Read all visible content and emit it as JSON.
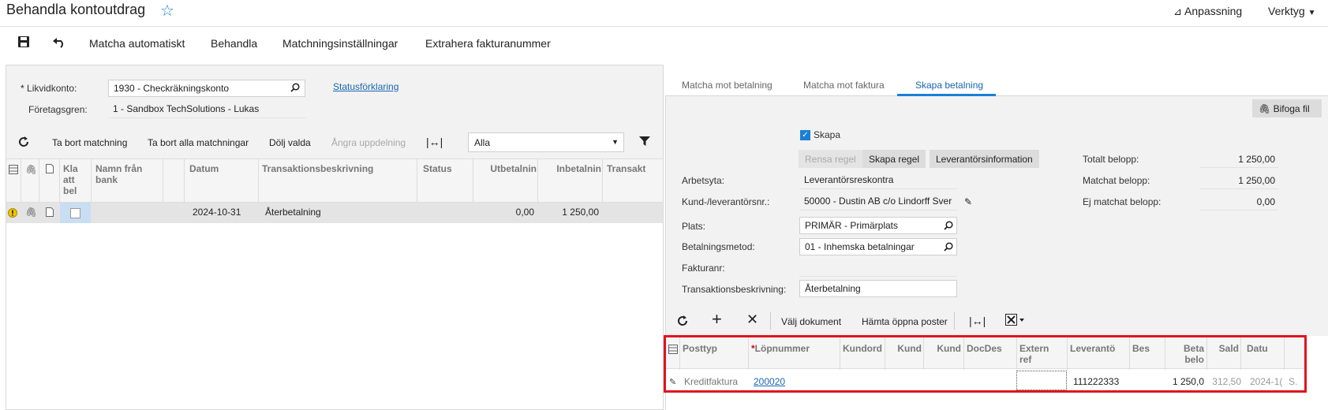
{
  "header": {
    "title": "Behandla kontoutdrag",
    "customize_label": "Anpassning",
    "tools_label": "Verktyg"
  },
  "toolbar": {
    "match_auto": "Matcha automatiskt",
    "process": "Behandla",
    "match_settings": "Matchningsinställningar",
    "extract_invoice": "Extrahera fakturanummer"
  },
  "left_form": {
    "cash_account_label": "Likvidkonto:",
    "cash_account_value": "1930 - Checkräkningskonto",
    "branch_label": "Företagsgren:",
    "branch_value": "1 - Sandbox TechSolutions - Lukas",
    "status_link": "Statusförklaring"
  },
  "left_grid_toolbar": {
    "remove_match": "Ta bort matchning",
    "remove_all": "Ta bort alla matchningar",
    "hide_processed": "Dölj valda",
    "undo_split": "Ångra uppdelning",
    "filter_value": "Alla"
  },
  "left_grid": {
    "columns": {
      "ready": "Kla\natt\nbel",
      "bank_name": "Namn från\nbank",
      "date": "Datum",
      "description": "Transaktionsbeskrivning",
      "status": "Status",
      "payment_out": "Utbetalnin",
      "payment_in": "Inbetalnin",
      "transaction": "Transakt"
    },
    "rows": [
      {
        "date": "2024-10-31",
        "description": "Återbetalning",
        "payment_out": "0,00",
        "payment_in": "1 250,00"
      }
    ]
  },
  "tabs": {
    "match_payment": "Matcha mot betalning",
    "match_invoice": "Matcha mot faktura",
    "create_payment": "Skapa betalning"
  },
  "right_form": {
    "attach_file": "Bifoga fil",
    "create_label": "Skapa",
    "clear_rule": "Rensa regel",
    "create_rule": "Skapa regel",
    "vendor_info": "Leverantörsinformation",
    "module_label": "Arbetsyta:",
    "module_value": "Leverantörsreskontra",
    "vendor_label": "Kund-/leverantörsnr.:",
    "vendor_value": "50000 - Dustin AB c/o Lindorff Sver",
    "location_label": "Plats:",
    "location_value": "PRIMÄR - Primärplats",
    "payment_method_label": "Betalningsmetod:",
    "payment_method_value": "01 - Inhemska betalningar",
    "invoice_no_label": "Fakturanr:",
    "invoice_no_value": "",
    "trans_desc_label": "Transaktionsbeskrivning:",
    "trans_desc_value": "Återbetalning",
    "total_label": "Totalt belopp:",
    "total_value": "1 250,00",
    "matched_label": "Matchat belopp:",
    "matched_value": "1 250,00",
    "unmatched_label": "Ej matchat belopp:",
    "unmatched_value": "0,00"
  },
  "right_grid_toolbar": {
    "select_doc": "Välj dokument",
    "load_open": "Hämta öppna poster"
  },
  "right_grid": {
    "columns": {
      "doc_type": "Posttyp",
      "ref_nbr": "Löpnummer",
      "customer_order": "Kundord",
      "kund1": "Kund",
      "kund2": "Kund",
      "docdesc": "DocDes",
      "ext_ref": "Extern\nref",
      "vendor": "Leverantö",
      "bes": "Bes",
      "pay_amount": "Beta\nbelo",
      "balance": "Sald",
      "date": "Datu"
    },
    "rows": [
      {
        "doc_type": "Kreditfaktura",
        "ref_nbr": "200020",
        "vendor": "111222333",
        "pay_amount": "1 250,0",
        "balance": "312,50",
        "date": "2024-1(",
        "extra": "S."
      }
    ]
  },
  "colors": {
    "accent": "#1a7fd4",
    "highlight": "#e0141e",
    "link": "#1a66b3"
  }
}
